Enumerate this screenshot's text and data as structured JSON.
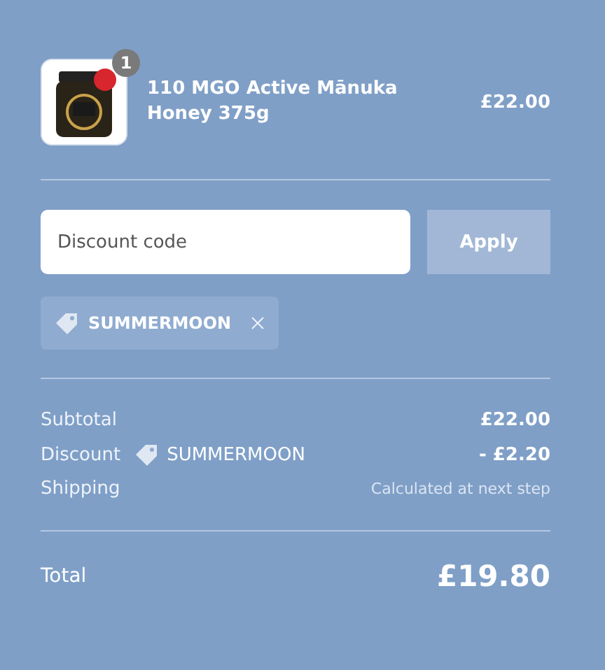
{
  "line_items": [
    {
      "quantity": "1",
      "name": "110 MGO Active Mānuka Honey 375g",
      "price": "£22.00"
    }
  ],
  "discount": {
    "placeholder": "Discount code",
    "button": "Apply",
    "applied_codes": [
      "SUMMERMOON"
    ]
  },
  "summary": [
    {
      "label": "Subtotal",
      "value": "£22.00",
      "kind": "amount"
    },
    {
      "label": "Discount",
      "code": "SUMMERMOON",
      "value": "- £2.20",
      "kind": "discount"
    },
    {
      "label": "Shipping",
      "value": "Calculated at next step",
      "kind": "note"
    }
  ],
  "total": {
    "label": "Total",
    "value": "£19.80"
  }
}
